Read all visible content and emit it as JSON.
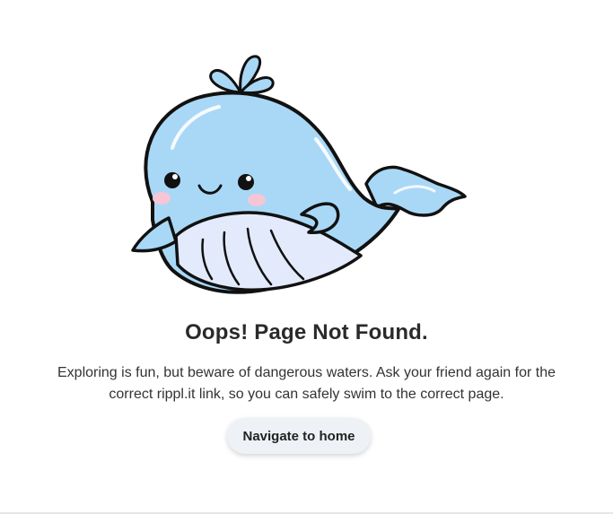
{
  "illustration": {
    "icon": "whale-illustration",
    "colors": {
      "body": "#a9d8f7",
      "belly": "#e3eafc",
      "outline": "#111111",
      "cheek": "#f6c6d6"
    }
  },
  "content": {
    "title": "Oops! Page Not Found.",
    "message": "Exploring is fun, but beware of dangerous waters. Ask your friend again for the correct rippl.it link, so you can safely swim to the correct page.",
    "button_label": "Navigate to home"
  }
}
